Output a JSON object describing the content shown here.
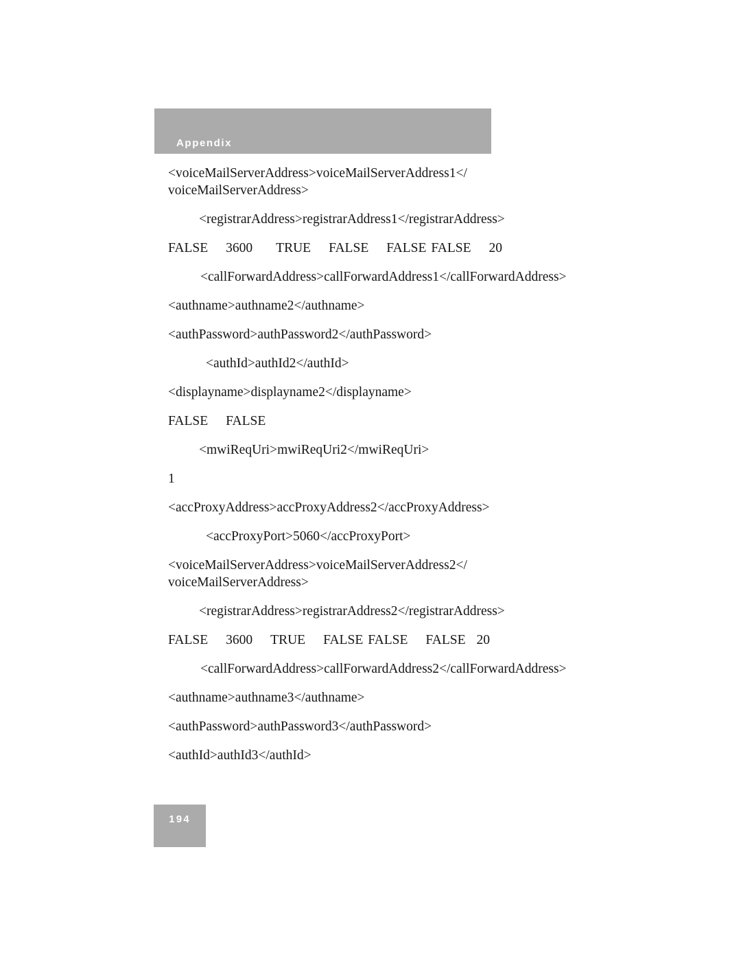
{
  "document": {
    "header": {
      "label": "Appendix",
      "band_color": "#ababab",
      "text_color": "#ffffff"
    },
    "footer": {
      "page_number": "194",
      "box_color": "#ababab",
      "text_color": "#ffffff"
    },
    "lines": [
      {
        "id": "voicemail-1",
        "indent": 0,
        "wrapped": true,
        "text": "<voiceMailServerAddress>voiceMailServerAddress1</voiceMailServerAddress>"
      },
      {
        "id": "registrar-1",
        "indent": 1,
        "wrapped": false,
        "text": "<registrarAddress>registrarAddress1</registrarAddress>"
      },
      {
        "id": "values-row-1",
        "indent": 2,
        "type": "values",
        "tokens": [
          "FALSE",
          "3600",
          "TRUE",
          "FALSE",
          "FALSE",
          "FALSE",
          "20"
        ],
        "gaps": [
          "gap-l",
          "gap-xl",
          "gap-l",
          "gap-l",
          "gap-s",
          "gap-l"
        ],
        "text": "FALSE   3600    TRUE   FALSE   FALSE FALSE  20"
      },
      {
        "id": "callforward-1",
        "indent": 2,
        "wrapped": false,
        "text": "<callForwardAddress>callForwardAddress1</callForwardAddress>"
      },
      {
        "id": "authname-2",
        "indent": 0,
        "wrapped": false,
        "text": "<authname>authname2</authname>"
      },
      {
        "id": "authpassword-2",
        "indent": 0,
        "wrapped": false,
        "text": "<authPassword>authPassword2</authPassword>"
      },
      {
        "id": "authid-2",
        "indent": 3,
        "wrapped": false,
        "text": "<authId>authId2</authId>"
      },
      {
        "id": "displayname-2",
        "indent": 0,
        "wrapped": false,
        "text": "<displayname>displayname2</displayname>"
      },
      {
        "id": "values-row-2",
        "indent": 4,
        "type": "values",
        "tokens": [
          "FALSE",
          "FALSE"
        ],
        "gaps": [
          "gap-l"
        ],
        "text": "FALSE   FALSE"
      },
      {
        "id": "mwirequri-2",
        "indent": 1,
        "wrapped": false,
        "text": "<mwiReqUri>mwiReqUri2</mwiReqUri>"
      },
      {
        "id": "values-row-3",
        "indent": 4,
        "type": "values",
        "tokens": [
          "1"
        ],
        "gaps": [],
        "text": "1"
      },
      {
        "id": "accproxyaddress-2",
        "indent": 0,
        "wrapped": false,
        "text": "<accProxyAddress>accProxyAddress2</accProxyAddress>"
      },
      {
        "id": "accproxyport-2",
        "indent": 3,
        "wrapped": false,
        "text": "<accProxyPort>5060</accProxyPort>"
      },
      {
        "id": "voicemail-2",
        "indent": 0,
        "wrapped": true,
        "text": "<voiceMailServerAddress>voiceMailServerAddress2</voiceMailServerAddress>"
      },
      {
        "id": "registrar-2",
        "indent": 1,
        "wrapped": false,
        "text": "<registrarAddress>registrarAddress2</registrarAddress>"
      },
      {
        "id": "values-row-4",
        "indent": 5,
        "type": "values",
        "tokens": [
          "FALSE",
          "3600",
          "TRUE",
          "FALSE",
          "FALSE",
          "FALSE",
          "20"
        ],
        "gaps": [
          "gap-l",
          "gap-l",
          "gap-l",
          "gap-s",
          "gap-l",
          "gap-m"
        ],
        "text": "FALSE   3600   TRUE   FALSE FALSE   FALSE  20"
      },
      {
        "id": "callforward-2",
        "indent": 2,
        "wrapped": false,
        "text": "<callForwardAddress>callForwardAddress2</callForwardAddress>"
      },
      {
        "id": "authname-3",
        "indent": 0,
        "wrapped": false,
        "text": "<authname>authname3</authname>"
      },
      {
        "id": "authpassword-3",
        "indent": 0,
        "wrapped": false,
        "text": "<authPassword>authPassword3</authPassword>"
      },
      {
        "id": "authid-3",
        "indent": 0,
        "wrapped": false,
        "text": "<authId>authId3</authId>"
      }
    ]
  }
}
